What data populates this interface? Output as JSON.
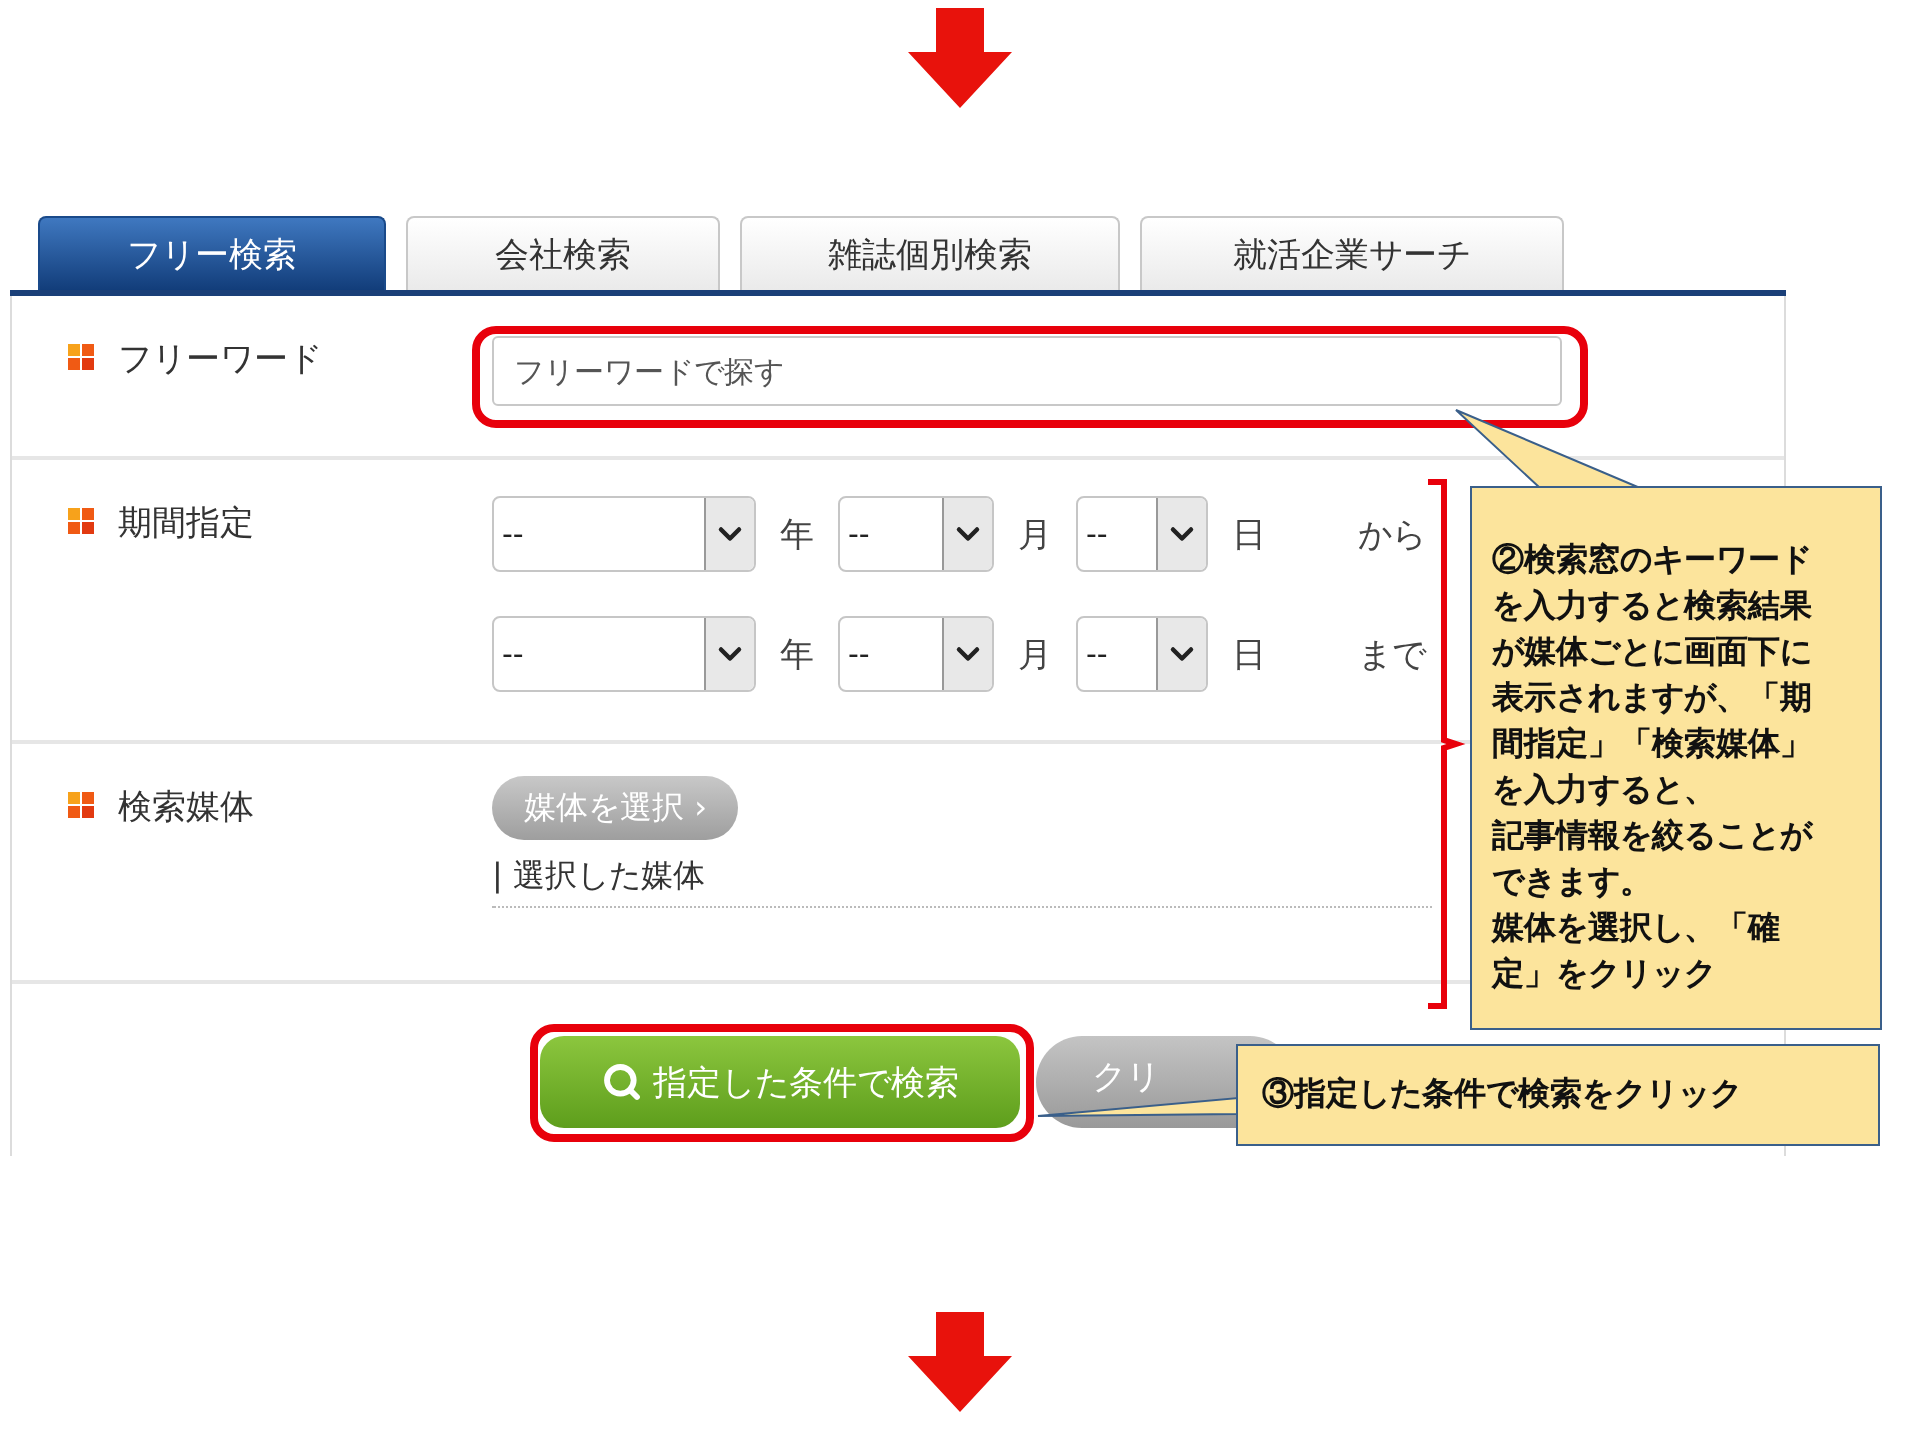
{
  "tabs": [
    {
      "label": "フリー検索",
      "selected": true
    },
    {
      "label": "会社検索",
      "selected": false
    },
    {
      "label": "雑誌個別検索",
      "selected": false
    },
    {
      "label": "就活企業サーチ",
      "selected": false
    }
  ],
  "free_word": {
    "label": "フリーワード",
    "placeholder": "フリーワードで探す"
  },
  "period": {
    "label": "期間指定",
    "rows": [
      {
        "year": "--",
        "year_unit": "年",
        "month": "--",
        "month_unit": "月",
        "day": "--",
        "day_unit": "日",
        "suffix": "から"
      },
      {
        "year": "--",
        "year_unit": "年",
        "month": "--",
        "month_unit": "月",
        "day": "--",
        "day_unit": "日",
        "suffix": "まで"
      }
    ]
  },
  "media": {
    "label": "検索媒体",
    "button": "媒体を選択 ›",
    "selected_label": "| 選択した媒体"
  },
  "actions": {
    "search": "指定した条件で検索",
    "clear": "クリ"
  },
  "callouts": [
    {
      "kind": "tall",
      "lines": [
        "②検索窓のキーワード",
        "を入力すると検索結果",
        "が媒体ごとに画面下に",
        "表示されますが、「期",
        "間指定」「検索媒体」",
        "を入力すると、",
        "記事情報を絞ることが",
        "できます。",
        "媒体を選択し、「確",
        "定」をクリック"
      ]
    },
    {
      "kind": "wide",
      "lines": [
        "③指定した条件で検索をクリック"
      ]
    }
  ]
}
